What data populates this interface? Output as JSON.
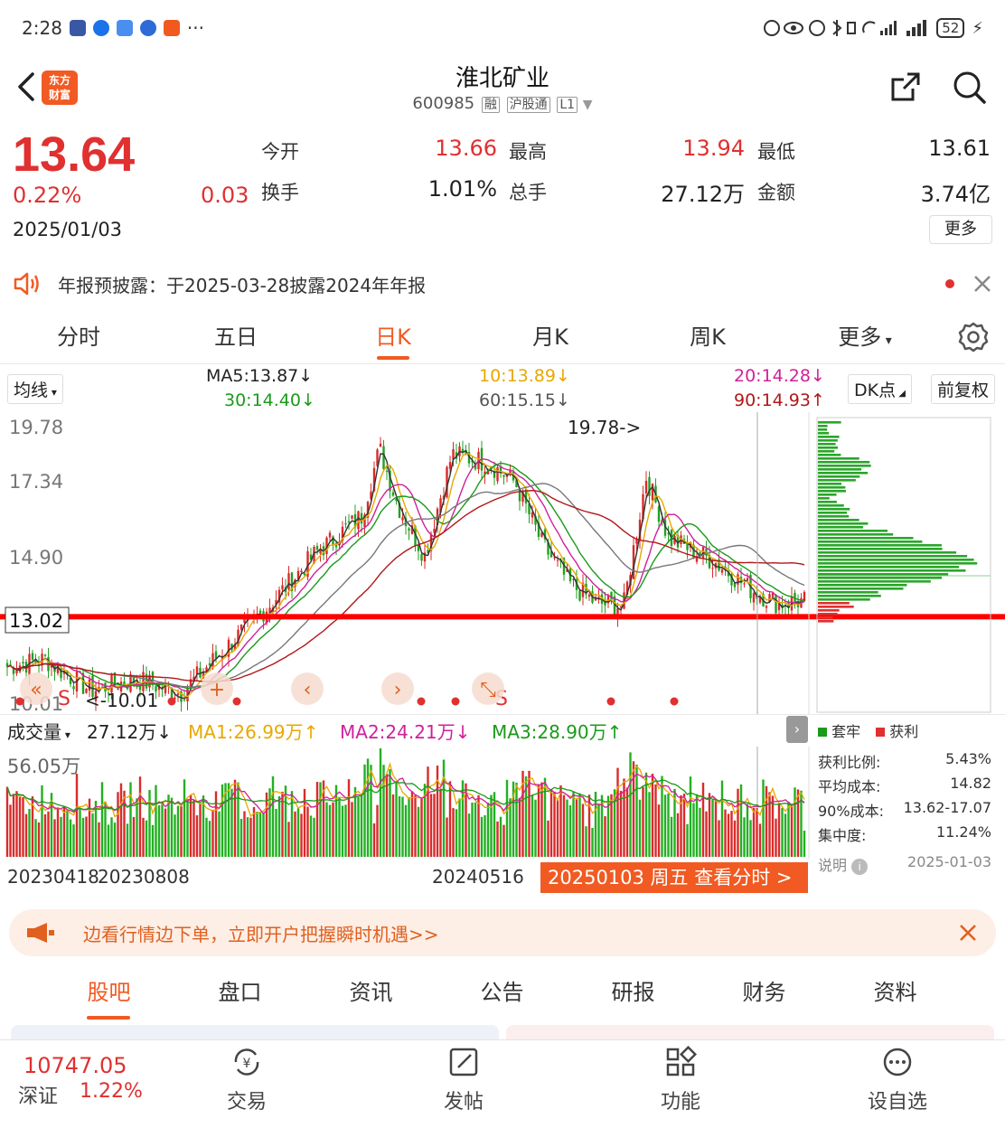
{
  "status_bar": {
    "time": "2:28",
    "dots": "···",
    "battery": "52"
  },
  "header": {
    "title": "淮北矿业",
    "code": "600985",
    "tags": [
      "融",
      "沪股通",
      "L1"
    ],
    "logo_line1": "东方",
    "logo_line2": "财富"
  },
  "quote": {
    "price": "13.64",
    "change_pct": "0.22%",
    "change": "0.03",
    "date": "2025/01/03",
    "stats": [
      {
        "label": "今开",
        "value": "13.66",
        "color": "#e03030"
      },
      {
        "label": "最高",
        "value": "13.94",
        "color": "#e03030"
      },
      {
        "label": "最低",
        "value": "13.61",
        "color": "#222222"
      },
      {
        "label": "换手",
        "value": "1.01%",
        "color": "#222222"
      },
      {
        "label": "总手",
        "value": "27.12万",
        "color": "#222222"
      },
      {
        "label": "金额",
        "value": "3.74亿",
        "color": "#222222"
      }
    ],
    "more": "更多"
  },
  "notice": {
    "text": "年报预披露：于2025-03-28披露2024年年报"
  },
  "chart_tabs": [
    "分时",
    "五日",
    "日K",
    "月K",
    "周K",
    "更多"
  ],
  "ma": {
    "selector": "均线",
    "ma5": "MA5:13.87",
    "ma10": "10:13.89",
    "ma20": "20:14.28",
    "ma30": "30:14.40",
    "ma60": "60:15.15",
    "ma90": "90:14.93",
    "dk": "DK点",
    "adjust": "前复权"
  },
  "kline": {
    "y_labels": [
      "19.78",
      "17.34",
      "14.90",
      "13.02",
      "10.01"
    ],
    "high_note": "19.78->",
    "low_note": "<-10.01",
    "signal_s": "S"
  },
  "volume": {
    "selector": "成交量",
    "current": "27.12万",
    "ma1": "MA1:26.99万",
    "ma2": "MA2:24.21万",
    "ma3": "MA3:28.90万",
    "max_label": "56.05万",
    "dates": [
      "20230418",
      "20230808",
      "20240516"
    ],
    "cursor_label": "20250103 周五 查看分时 >"
  },
  "cost": {
    "legend_a": "套牢",
    "legend_b": "获利",
    "rows": [
      {
        "label": "获利比例:",
        "value": "5.43%"
      },
      {
        "label": "平均成本:",
        "value": "14.82"
      },
      {
        "label": "90%成本:",
        "value": "13.62-17.07"
      },
      {
        "label": "集中度:",
        "value": "11.24%"
      }
    ],
    "note": "说明",
    "date": "2025-01-03"
  },
  "promo": {
    "text": "边看行情边下单，立即开户把握瞬时机遇>>"
  },
  "sub_tabs": [
    "股吧",
    "盘口",
    "资讯",
    "公告",
    "研报",
    "财务",
    "资料"
  ],
  "bottom_bar": {
    "index_value": "10747.05",
    "index_name": "深证",
    "index_pct": "1.22%",
    "items": [
      "交易",
      "发帖",
      "功能",
      "设自选"
    ]
  }
}
